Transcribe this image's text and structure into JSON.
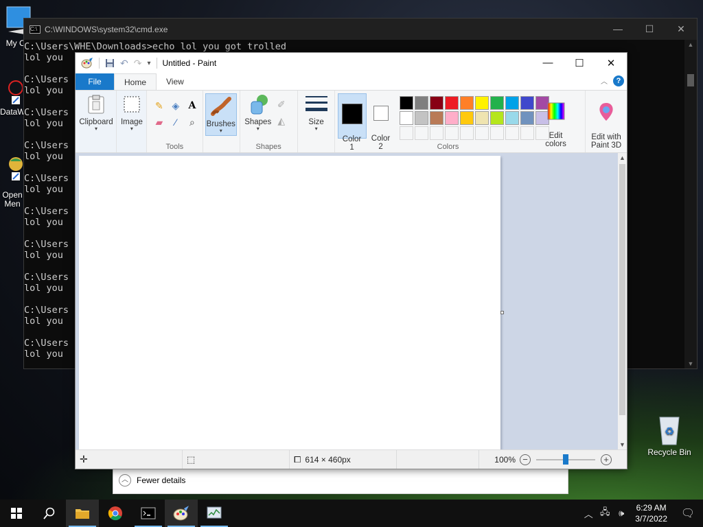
{
  "desktop": {
    "icons": [
      {
        "label": "My Co",
        "icon": "this-pc-icon"
      },
      {
        "label": "DataW",
        "icon": "datawrapper-icon"
      },
      {
        "label": "Open\nMen",
        "icon": "open-menu-icon"
      },
      {
        "label": "Recycle Bin",
        "icon": "recycle-bin-icon"
      }
    ]
  },
  "cmd": {
    "title": "C:\\WINDOWS\\system32\\cmd.exe",
    "lines": [
      "C:\\Users\\WHE\\Downloads>echo lol you got trolled",
      "lol you",
      "C:\\Users",
      "lol you",
      "C:\\Users",
      "lol you",
      "C:\\Users",
      "lol you",
      "C:\\Users",
      "lol you",
      "C:\\Users",
      "lol you",
      "C:\\Users",
      "lol you",
      "C:\\Users",
      "lol you",
      "C:\\Users",
      "lol you",
      "C:\\Users",
      "lol you"
    ]
  },
  "paint": {
    "title": "Untitled - Paint",
    "tabs": [
      "File",
      "Home",
      "View"
    ],
    "groups": {
      "clipboard": "Clipboard",
      "image": "Image",
      "tools": "Tools",
      "brushes": "Brushes",
      "shapes_btn": "Shapes",
      "shapes": "Shapes",
      "size": "Size",
      "color1": "Color\n1",
      "color2": "Color\n2",
      "colors": "Colors",
      "edit_colors": "Edit\ncolors",
      "edit_paint3d": "Edit with\nPaint 3D"
    },
    "palette_row1": [
      "#000000",
      "#7f7f7f",
      "#880015",
      "#ed1c24",
      "#ff7f27",
      "#fff200",
      "#22b14c",
      "#00a2e8",
      "#3f48cc",
      "#a349a4"
    ],
    "palette_row2": [
      "#ffffff",
      "#c3c3c3",
      "#b97a57",
      "#ffaec9",
      "#ffc90e",
      "#efe4b0",
      "#b5e61d",
      "#99d9ea",
      "#7092be",
      "#c8bfe7"
    ],
    "color1_value": "#000000",
    "color2_value": "#ffffff",
    "status": {
      "size": "614 × 460px",
      "zoom": "100%",
      "zoom_level": 0.5
    }
  },
  "task_manager": {
    "fewer_details": "Fewer details"
  },
  "taskbar": {
    "time": "6:29 AM",
    "date": "3/7/2022"
  }
}
